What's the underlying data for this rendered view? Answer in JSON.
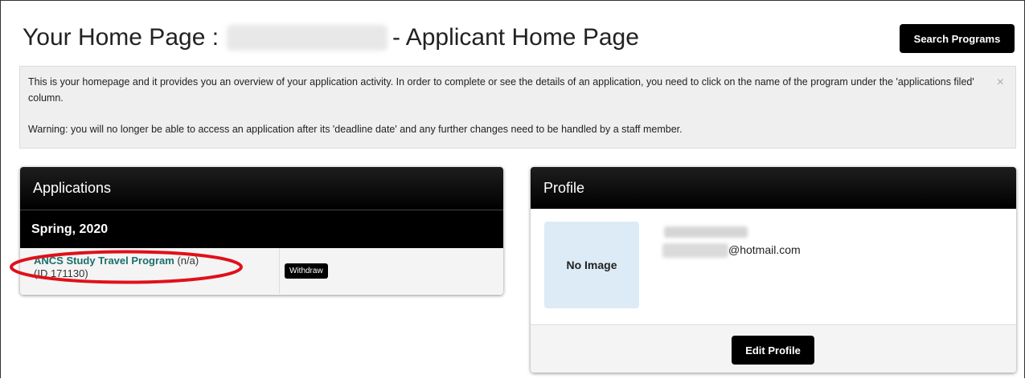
{
  "header": {
    "title_prefix": "Your Home Page :",
    "title_suffix": "- Applicant Home Page",
    "search_button": "Search Programs"
  },
  "notice": {
    "text1": "This is your homepage and it provides you an overview of your application activity. In order to complete or see the details of an application, you need to click on the name of the program under the 'applications filed' column.",
    "text2": "Warning: you will no longer be able to access an application after its 'deadline date' and any further changes need to be handled by a staff member.",
    "close": "×"
  },
  "applications": {
    "title": "Applications",
    "term": "Spring, 2020",
    "items": [
      {
        "program": "ANCS Study Travel Program",
        "status": "(n/a)",
        "id": "(ID 171130)",
        "action": "Withdraw"
      }
    ]
  },
  "profile": {
    "title": "Profile",
    "no_image": "No Image",
    "email_domain": "@hotmail.com",
    "edit_button": "Edit Profile"
  },
  "colors": {
    "link": "#1a6f6a",
    "highlight": "#e0101a",
    "image_placeholder": "#dcebf5"
  }
}
